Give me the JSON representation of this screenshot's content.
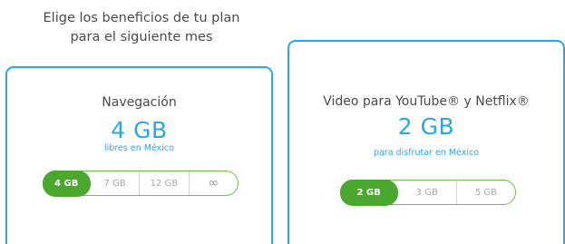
{
  "heading": {
    "line1": "Elige los beneficios de tu plan",
    "line2": "para el siguiente mes"
  },
  "cards": [
    {
      "title": "Navegación",
      "amount": "4 GB",
      "subtitle": "libres en México",
      "options": [
        "4 GB",
        "7 GB",
        "12 GB",
        "∞"
      ],
      "selected": "4 GB"
    },
    {
      "title": "Video para YouTube® y Netflix®",
      "amount": "2 GB",
      "subtitle": "para disfrutar en México",
      "options": [
        "2 GB",
        "3 GB",
        "5 GB"
      ],
      "selected": "2 GB"
    }
  ],
  "colors": {
    "accent_blue": "#2aa8e6",
    "accent_green": "#4aa82e",
    "selector_border": "#6cc04a"
  }
}
